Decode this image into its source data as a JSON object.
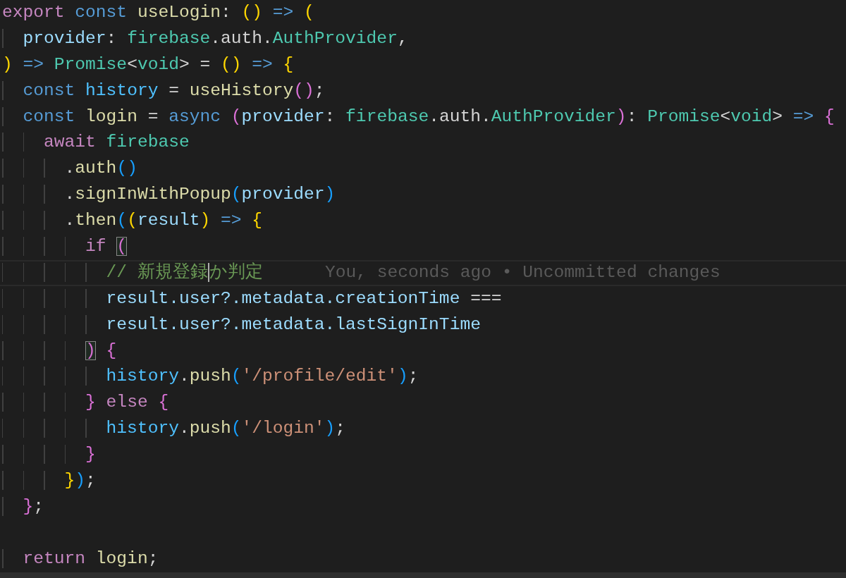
{
  "editor": {
    "blocks": [
      {
        "lines": [
          {
            "tokens": [
              {
                "kind": "control",
                "text": "export "
              },
              {
                "kind": "storage",
                "text": "const "
              },
              {
                "kind": "function",
                "text": "useLogin"
              },
              {
                "kind": "plain",
                "text": ": "
              },
              {
                "kind": "bracket1",
                "text": "() "
              },
              {
                "kind": "storage",
                "text": "=> "
              },
              {
                "kind": "bracket1",
                "text": "("
              }
            ]
          },
          {
            "tokens": [
              {
                "kind": "param",
                "text": "  provider"
              },
              {
                "kind": "plain",
                "text": ": "
              },
              {
                "kind": "type",
                "text": "firebase"
              },
              {
                "kind": "plain",
                "text": ".auth."
              },
              {
                "kind": "type",
                "text": "AuthProvider"
              },
              {
                "kind": "plain",
                "text": ","
              }
            ]
          },
          {
            "tokens": [
              {
                "kind": "bracket1",
                "text": ") "
              },
              {
                "kind": "storage",
                "text": "=> "
              },
              {
                "kind": "type",
                "text": "Promise"
              },
              {
                "kind": "plain",
                "text": "<"
              },
              {
                "kind": "type",
                "text": "void"
              },
              {
                "kind": "plain",
                "text": "> = "
              },
              {
                "kind": "bracket1",
                "text": "() "
              },
              {
                "kind": "storage",
                "text": "=> "
              },
              {
                "kind": "bracket1",
                "text": "{"
              }
            ]
          },
          {
            "tokens": [
              {
                "kind": "storage",
                "text": "  const "
              },
              {
                "kind": "constant",
                "text": "history"
              },
              {
                "kind": "plain",
                "text": " = "
              },
              {
                "kind": "function",
                "text": "useHistory"
              },
              {
                "kind": "bracket2",
                "text": "()"
              },
              {
                "kind": "plain",
                "text": ";"
              }
            ]
          },
          {
            "tokens": [
              {
                "kind": "storage",
                "text": "  const "
              },
              {
                "kind": "function",
                "text": "login"
              },
              {
                "kind": "plain",
                "text": " = "
              },
              {
                "kind": "storage",
                "text": "async "
              },
              {
                "kind": "bracket2",
                "text": "("
              },
              {
                "kind": "param",
                "text": "provider"
              },
              {
                "kind": "plain",
                "text": ": "
              },
              {
                "kind": "type",
                "text": "firebase"
              },
              {
                "kind": "plain",
                "text": ".auth."
              },
              {
                "kind": "type",
                "text": "AuthProvider"
              },
              {
                "kind": "bracket2",
                "text": ")"
              },
              {
                "kind": "plain",
                "text": ": "
              },
              {
                "kind": "type",
                "text": "Promise"
              },
              {
                "kind": "plain",
                "text": "<"
              },
              {
                "kind": "type",
                "text": "void"
              },
              {
                "kind": "plain",
                "text": "> "
              },
              {
                "kind": "storage",
                "text": "=> "
              },
              {
                "kind": "bracket2",
                "text": "{"
              }
            ]
          },
          {
            "tokens": [
              {
                "kind": "control",
                "text": "    await "
              },
              {
                "kind": "type",
                "text": "firebase"
              }
            ]
          },
          {
            "tokens": [
              {
                "kind": "plain",
                "text": "      ."
              },
              {
                "kind": "function",
                "text": "auth"
              },
              {
                "kind": "bracket3",
                "text": "()"
              }
            ]
          },
          {
            "tokens": [
              {
                "kind": "plain",
                "text": "      ."
              },
              {
                "kind": "function",
                "text": "signInWithPopup"
              },
              {
                "kind": "bracket3",
                "text": "("
              },
              {
                "kind": "param",
                "text": "provider"
              },
              {
                "kind": "bracket3",
                "text": ")"
              }
            ]
          },
          {
            "tokens": [
              {
                "kind": "plain",
                "text": "      ."
              },
              {
                "kind": "function",
                "text": "then"
              },
              {
                "kind": "bracket3",
                "text": "("
              },
              {
                "kind": "bracket1",
                "text": "("
              },
              {
                "kind": "param",
                "text": "result"
              },
              {
                "kind": "bracket1",
                "text": ") "
              },
              {
                "kind": "storage",
                "text": "=> "
              },
              {
                "kind": "bracket1",
                "text": "{"
              }
            ]
          },
          {
            "tokens": [
              {
                "kind": "control",
                "text": "        if "
              },
              {
                "kind": "bracket2",
                "text": "(",
                "matched": true
              }
            ]
          },
          {
            "current": true,
            "blame": "You, seconds ago • Uncommitted changes",
            "tokens": [
              {
                "kind": "comment",
                "text": "          // 新規登録"
              },
              {
                "kind": "comment",
                "text": "か判定",
                "caret_before": true
              }
            ]
          },
          {
            "tokens": [
              {
                "kind": "param",
                "text": "          result.user?.metadata.creationTime"
              },
              {
                "kind": "plain",
                "text": " ==="
              }
            ]
          },
          {
            "tokens": [
              {
                "kind": "param",
                "text": "          result.user?.metadata.lastSignInTime"
              }
            ]
          },
          {
            "tokens": [
              {
                "kind": "bracket2",
                "text": "        )",
                "matched": true
              },
              {
                "kind": "bracket2",
                "text": " {"
              }
            ]
          },
          {
            "tokens": [
              {
                "kind": "constant",
                "text": "          history"
              },
              {
                "kind": "plain",
                "text": "."
              },
              {
                "kind": "function",
                "text": "push"
              },
              {
                "kind": "bracket3",
                "text": "("
              },
              {
                "kind": "string",
                "text": "'/profile/edit'"
              },
              {
                "kind": "bracket3",
                "text": ")"
              },
              {
                "kind": "plain",
                "text": ";"
              }
            ]
          },
          {
            "tokens": [
              {
                "kind": "bracket2",
                "text": "        } "
              },
              {
                "kind": "control",
                "text": "else "
              },
              {
                "kind": "bracket2",
                "text": "{"
              }
            ]
          },
          {
            "tokens": [
              {
                "kind": "constant",
                "text": "          history"
              },
              {
                "kind": "plain",
                "text": "."
              },
              {
                "kind": "function",
                "text": "push"
              },
              {
                "kind": "bracket3",
                "text": "("
              },
              {
                "kind": "string",
                "text": "'/login'"
              },
              {
                "kind": "bracket3",
                "text": ")"
              },
              {
                "kind": "plain",
                "text": ";"
              }
            ]
          },
          {
            "tokens": [
              {
                "kind": "bracket2",
                "text": "        }"
              }
            ]
          },
          {
            "tokens": [
              {
                "kind": "bracket1",
                "text": "      }"
              },
              {
                "kind": "bracket3",
                "text": ")"
              },
              {
                "kind": "plain",
                "text": ";"
              }
            ]
          },
          {
            "tokens": [
              {
                "kind": "bracket2",
                "text": "  }"
              },
              {
                "kind": "plain",
                "text": ";"
              }
            ]
          }
        ]
      },
      {
        "lines": [
          {
            "tokens": [
              {
                "kind": "control",
                "text": "  return "
              },
              {
                "kind": "function",
                "text": "login"
              },
              {
                "kind": "plain",
                "text": ";"
              }
            ]
          }
        ]
      }
    ]
  }
}
